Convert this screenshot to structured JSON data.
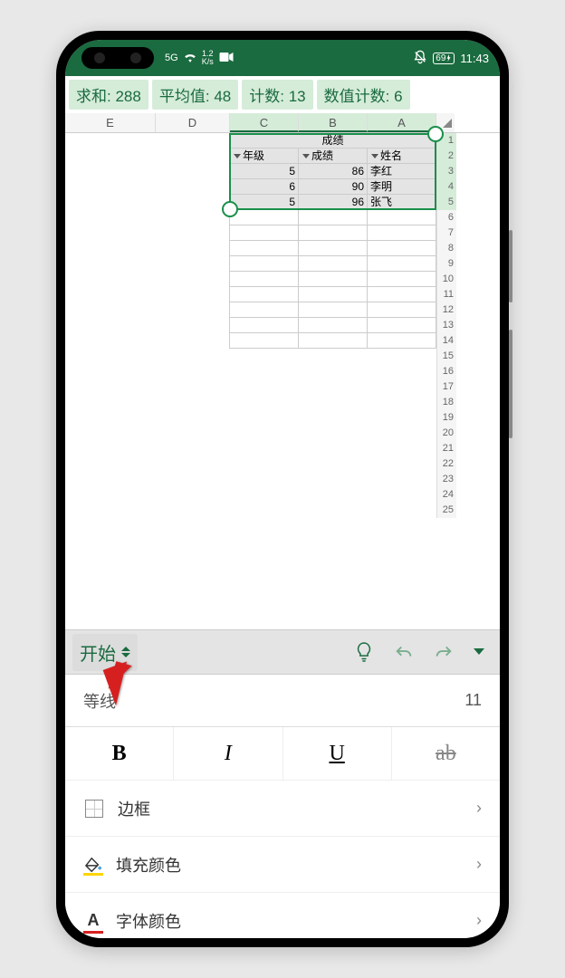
{
  "status": {
    "net_label": "5G",
    "speed_value": "1.2",
    "speed_unit": "K/s",
    "battery": "69",
    "time": "11:43"
  },
  "summary": {
    "sum_label": "求和:",
    "sum_value": "288",
    "avg_label": "平均值:",
    "avg_value": "48",
    "count_label": "计数:",
    "count_value": "13",
    "numcount_label": "数值计数:",
    "numcount_value": "6"
  },
  "columns": [
    "E",
    "D",
    "C",
    "B",
    "A"
  ],
  "table": {
    "title": "成绩",
    "headers": {
      "c": "年级",
      "b": "成绩",
      "a": "姓名"
    },
    "rows": [
      {
        "c": "5",
        "b": "86",
        "a": "李红"
      },
      {
        "c": "6",
        "b": "90",
        "a": "李明"
      },
      {
        "c": "5",
        "b": "96",
        "a": "张飞"
      }
    ]
  },
  "row_count": 25,
  "toolbar": {
    "tab": "开始"
  },
  "font": {
    "name": "等线",
    "size": "11"
  },
  "format_buttons": {
    "bold": "B",
    "italic": "I",
    "underline": "U",
    "strike": "ab"
  },
  "panel": {
    "border": "边框",
    "fill": "填充颜色",
    "fontcolor": "字体颜色"
  }
}
